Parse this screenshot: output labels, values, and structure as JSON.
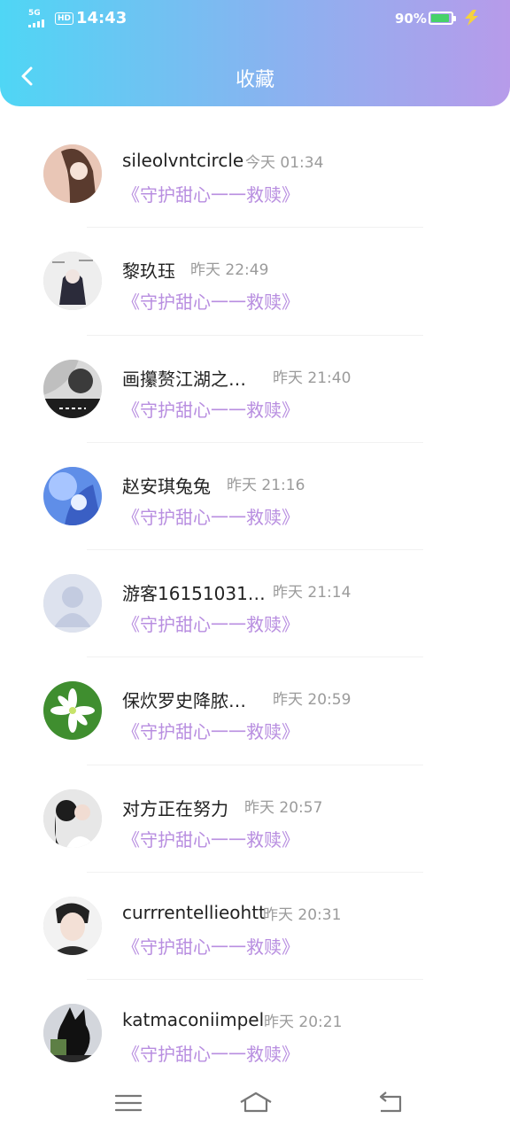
{
  "status_bar": {
    "network": "5G",
    "hd": "HD",
    "time": "14:43",
    "battery_percent": "90%",
    "battery_level": 0.9,
    "battery_color": "#46d26a"
  },
  "header": {
    "title": "收藏",
    "back_icon": "chevron-left-icon",
    "gradient": [
      "#4fd6f5",
      "#8ab2f0",
      "#b79bea"
    ]
  },
  "favorites": [
    {
      "user": "sileolvntcircle",
      "time": "今天 01:34",
      "book": "《守护甜心一一救赎》"
    },
    {
      "user": "黎玖珏",
      "time": "昨天 22:49",
      "book": "《守护甜心一一救赎》"
    },
    {
      "user": "画攥赘江湖之…",
      "time": "昨天 21:40",
      "book": "《守护甜心一一救赎》"
    },
    {
      "user": "赵安琪兔兔",
      "time": "昨天 21:16",
      "book": "《守护甜心一一救赎》"
    },
    {
      "user": "游客16151031…",
      "time": "昨天 21:14",
      "book": "《守护甜心一一救赎》"
    },
    {
      "user": "保炊罗史降脓…",
      "time": "昨天 20:59",
      "book": "《守护甜心一一救赎》"
    },
    {
      "user": "对方正在努力",
      "time": "昨天 20:57",
      "book": "《守护甜心一一救赎》"
    },
    {
      "user": "currrentellieohtt",
      "time": "昨天 20:31",
      "book": "《守护甜心一一救赎》"
    },
    {
      "user": "katmaconiimpel",
      "time": "昨天 20:21",
      "book": "《守护甜心一一救赎》"
    }
  ],
  "book_color": "#b88ee0",
  "bottom_nav": {
    "icons": [
      "menu-icon",
      "home-icon",
      "back-icon"
    ]
  }
}
